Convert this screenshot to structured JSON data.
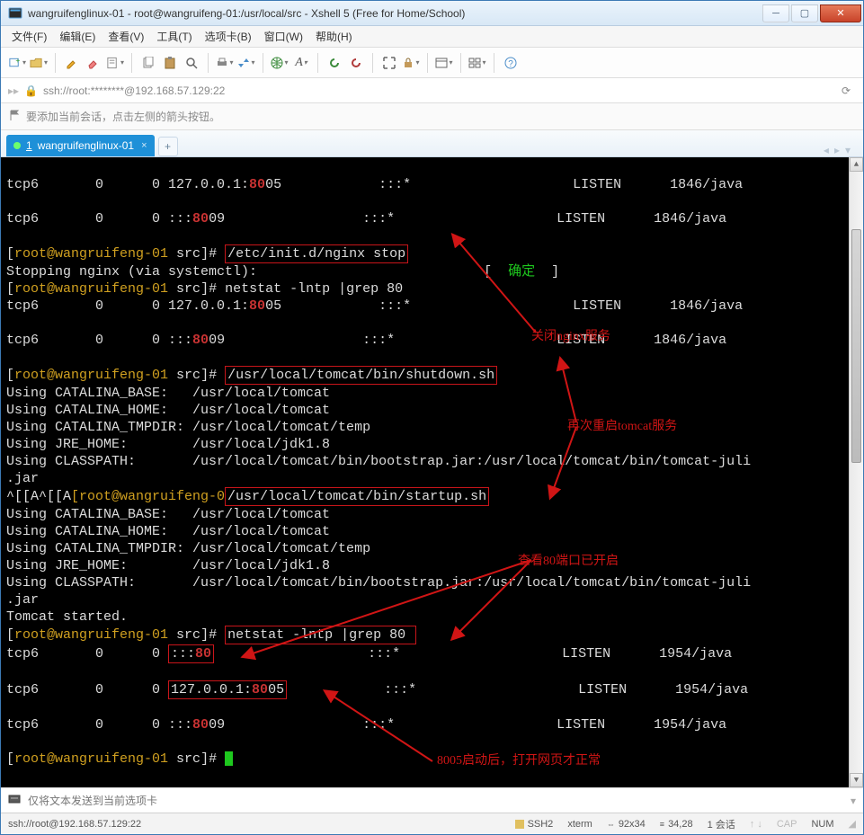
{
  "window": {
    "title": "wangruifenglinux-01 - root@wangruifeng-01:/usr/local/src - Xshell 5 (Free for Home/School)"
  },
  "menu": {
    "file": "文件(F)",
    "edit": "编辑(E)",
    "view": "查看(V)",
    "tools": "工具(T)",
    "tabs": "选项卡(B)",
    "window": "窗口(W)",
    "help": "帮助(H)"
  },
  "address": {
    "lock": "🔒",
    "text": "ssh://root:********@192.168.57.129:22"
  },
  "hint": {
    "text": "要添加当前会话，点击左侧的箭头按钮。"
  },
  "tab": {
    "index": "1",
    "title": "wangruifenglinux-01"
  },
  "term": {
    "l1a": "tcp6       0      0 127.0.0.1:",
    "l1b": "80",
    "l1c": "05            :::*                    LISTEN      1846/java",
    "blank": "",
    "l2a": "tcp6       0      0 :::",
    "l2b": "80",
    "l2c": "09                 :::*                    LISTEN      1846/java",
    "prompt_open": "[",
    "prompt_user": "root@wangruifeng-01",
    "prompt_path": " src",
    "prompt_close": "]# ",
    "cmd_stop_nginx": "/etc/init.d/nginx stop",
    "stopping": "Stopping nginx (via systemctl):                            [  ",
    "ok": "确定",
    "ok_close": "  ]",
    "cmd_netstat1": "netstat -lntp |grep 80",
    "cmd_tomcat_shutdown": "/usr/local/tomcat/bin/shutdown.sh",
    "catalina_base": "Using CATALINA_BASE:   /usr/local/tomcat",
    "catalina_home": "Using CATALINA_HOME:   /usr/local/tomcat",
    "catalina_tmp": "Using CATALINA_TMPDIR: /usr/local/tomcat/temp",
    "jre_home": "Using JRE_HOME:        /usr/local/jdk1.8",
    "classpath1": "Using CLASSPATH:       /usr/local/tomcat/bin/bootstrap.jar:/usr/local/tomcat/bin/tomcat-juli",
    "jar": ".jar",
    "escape_prefix": "^[[A^[[A",
    "escape_prompt": "[root@wangruifeng-0",
    "cmd_tomcat_startup": "/usr/local/tomcat/bin/startup.sh",
    "tomcat_started": "Tomcat started.",
    "cmd_netstat2": "netstat -lntp |grep 80",
    "l3a": "tcp6       0      0 ",
    "l3a_box": ":::",
    "l3b": "80",
    "l3c": "                   :::*                    LISTEN      1954/java",
    "l4a": "tcp6       0      0 ",
    "l4a_box": "127.0.0.1:",
    "l4b": "80",
    "l4b2": "05",
    "l4c": "            :::*                    LISTEN      1954/java",
    "l5a": "tcp6       0      0 :::",
    "l5b": "80",
    "l5c": "09                 :::*                    LISTEN      1954/java"
  },
  "anno": {
    "a1": "关闭nginx服务",
    "a2": "再次重启tomcat服务",
    "a3": "查看80端口已开启",
    "a4": "8005启动后，打开网页才正常"
  },
  "bottom_input": {
    "placeholder": "仅将文本发送到当前选项卡"
  },
  "status": {
    "conn": "ssh://root@192.168.57.129:22",
    "ssh": "SSH2",
    "term": "xterm",
    "size": "92x34",
    "pos": "34,28",
    "sessions": "1 会话",
    "cap": "CAP",
    "num": "NUM"
  }
}
